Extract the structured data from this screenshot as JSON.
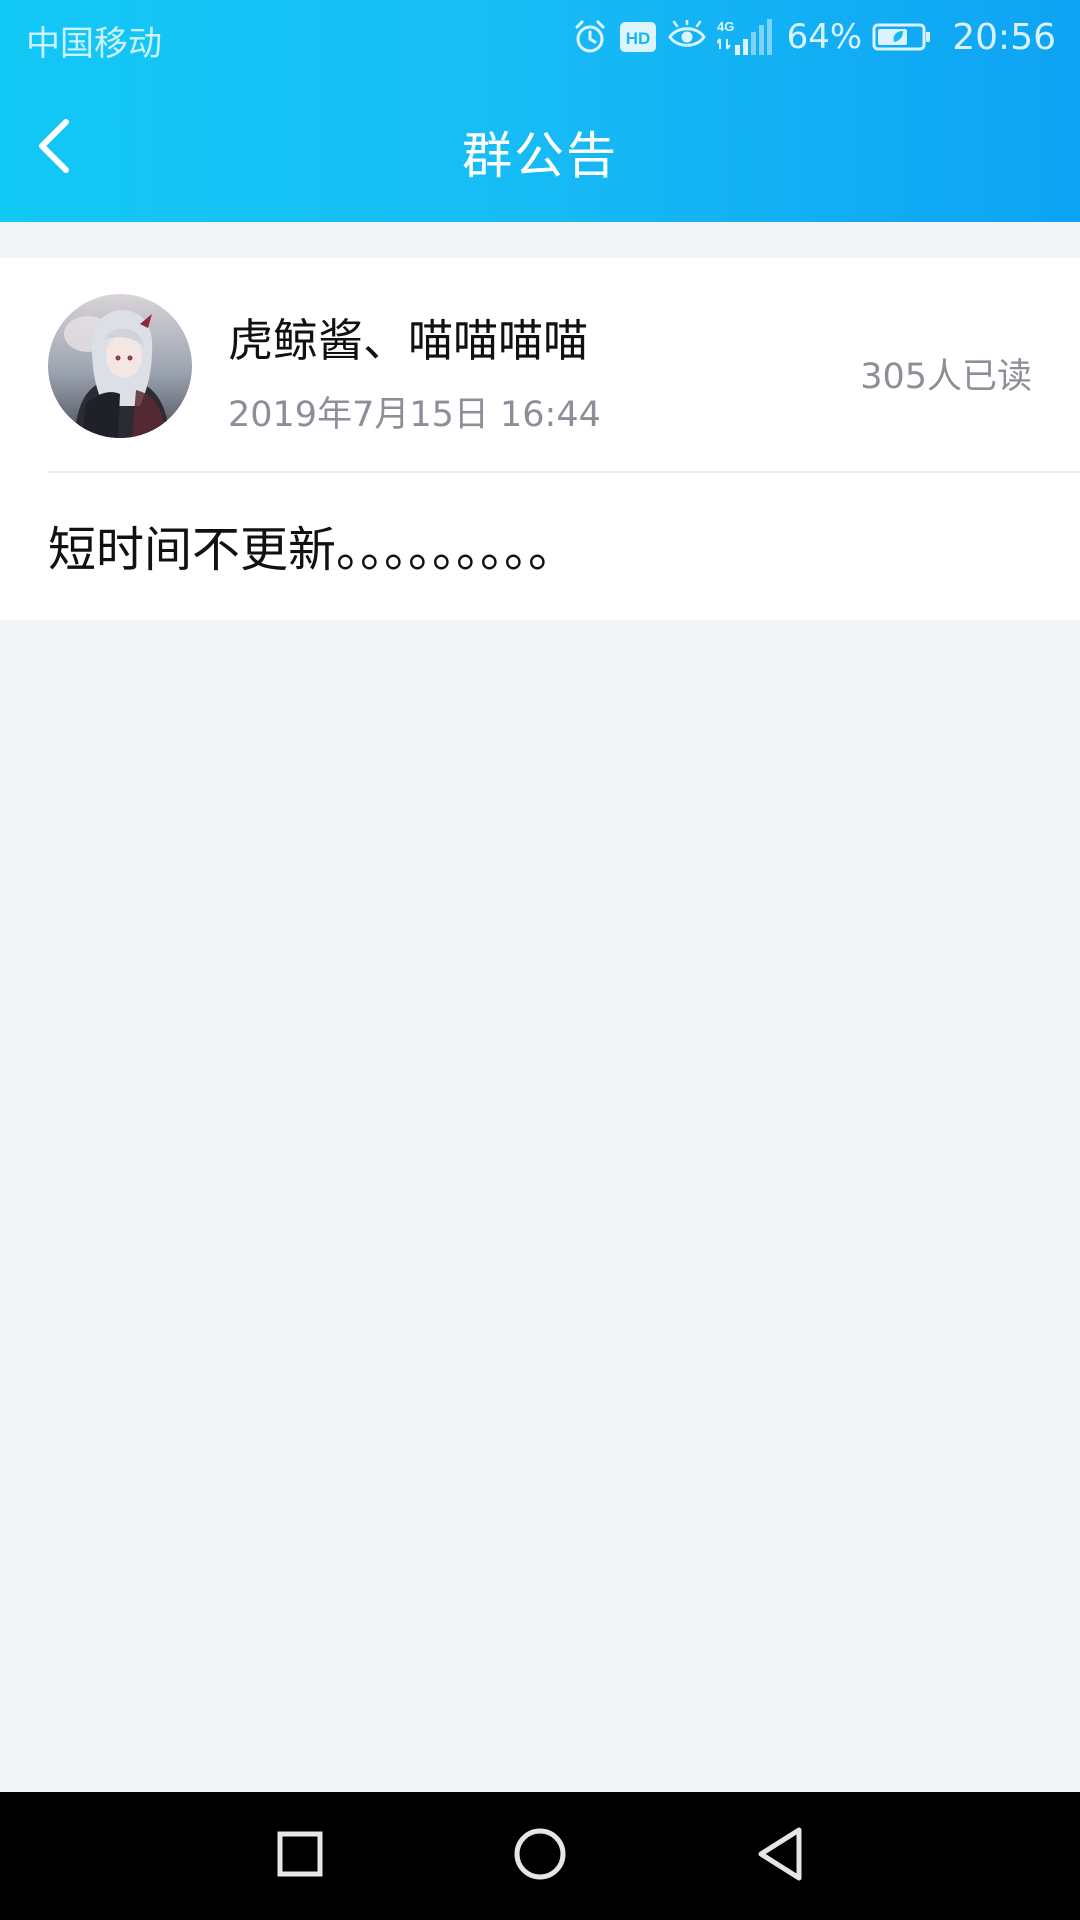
{
  "status_bar": {
    "carrier": "中国移动",
    "network": "4G",
    "battery_percent": "64%",
    "time": "20:56",
    "icons": [
      "alarm-icon",
      "hd-icon",
      "eye-icon",
      "signal-icon",
      "battery-icon"
    ]
  },
  "title_bar": {
    "back_icon": "chevron-left-icon",
    "title": "群公告"
  },
  "announcement": {
    "author": "虎鲸酱、喵喵喵喵",
    "date": "2019年7月15日 16:44",
    "read_count": "305人已读",
    "content": "短时间不更新。。。。。。。。。"
  },
  "nav_bar": {
    "icons": [
      "recent-apps-icon",
      "home-icon",
      "back-triangle-icon"
    ]
  },
  "colors": {
    "header_gradient_start": "#12c8f5",
    "header_gradient_end": "#0ea3f3",
    "page_background": "#f3f4f8",
    "secondary_text": "#8c8f98"
  }
}
